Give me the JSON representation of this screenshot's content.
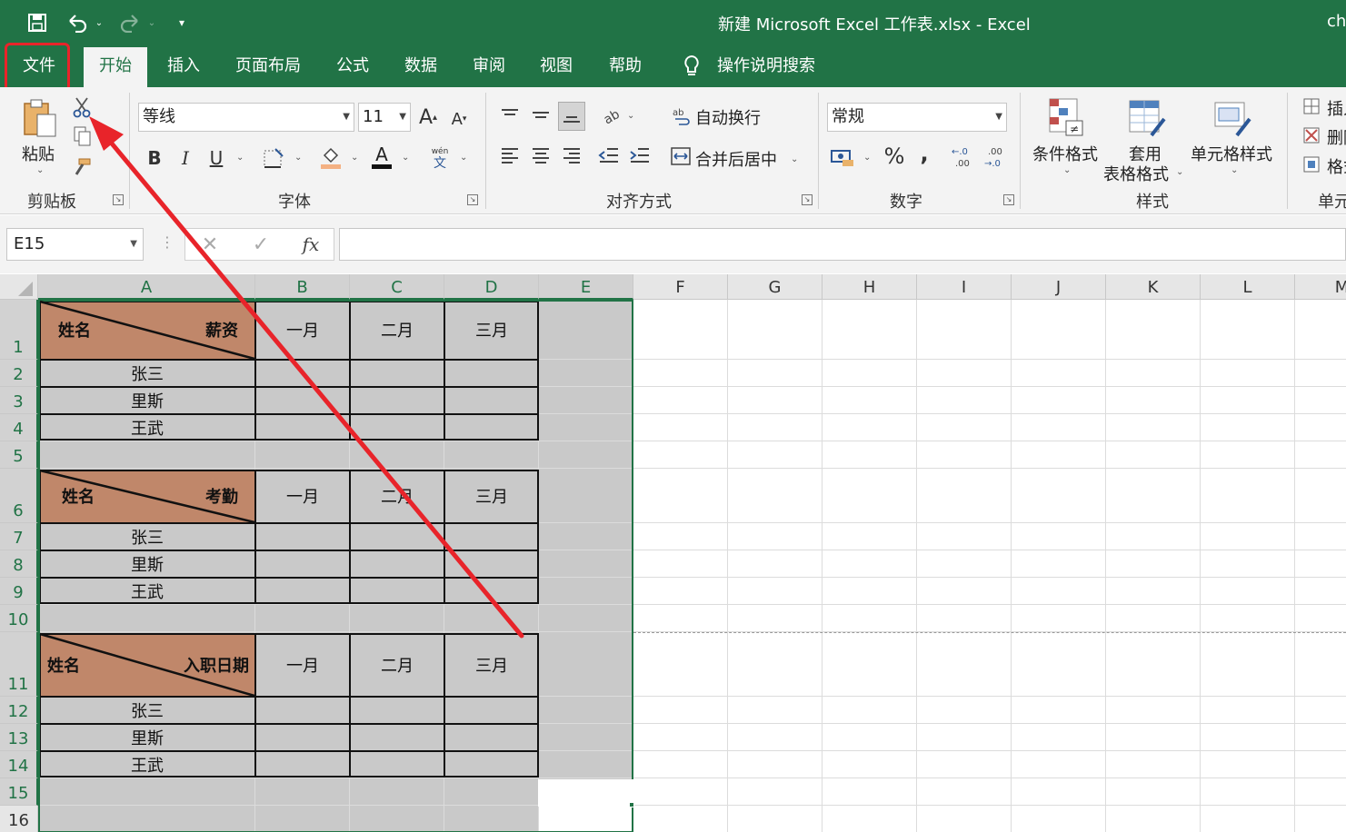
{
  "window": {
    "title": "新建 Microsoft Excel 工作表.xlsx  -  Excel",
    "user": "ch"
  },
  "tabs": {
    "file": "文件",
    "home": "开始",
    "insert": "插入",
    "layout": "页面布局",
    "formulas": "公式",
    "data": "数据",
    "review": "审阅",
    "view": "视图",
    "help": "帮助",
    "tell_me": "操作说明搜索"
  },
  "ribbon": {
    "clipboard": {
      "paste": "粘贴",
      "label": "剪贴板"
    },
    "font": {
      "name": "等线",
      "size": "11",
      "bold": "B",
      "italic": "I",
      "underline": "U",
      "label": "字体"
    },
    "alignment": {
      "wrap": "自动换行",
      "merge": "合并后居中",
      "label": "对齐方式"
    },
    "number": {
      "format": "常规",
      "percent": "%",
      "comma": ",",
      "label": "数字"
    },
    "styles": {
      "conditional_1": "条件格式",
      "table_1": "套用",
      "table_2": "表格格式",
      "cell_styles": "单元格样式",
      "label": "样式"
    },
    "cells": {
      "insert": "插入",
      "delete": "删除",
      "format": "格式",
      "label": "单元"
    }
  },
  "formula_bar": {
    "name_box": "E15",
    "fx": "fx",
    "value": ""
  },
  "columns": [
    "A",
    "B",
    "C",
    "D",
    "E",
    "F",
    "G",
    "H",
    "I",
    "J",
    "K",
    "L",
    "M"
  ],
  "rows": [
    "1",
    "2",
    "3",
    "4",
    "5",
    "6",
    "7",
    "8",
    "9",
    "10",
    "11",
    "12",
    "13",
    "14",
    "15",
    "16"
  ],
  "tables": [
    {
      "left_header": "姓名",
      "right_header": "薪资",
      "months": [
        "一月",
        "二月",
        "三月"
      ],
      "names": [
        "张三",
        "里斯",
        "王武"
      ]
    },
    {
      "left_header": "姓名",
      "right_header": "考勤",
      "months": [
        "一月",
        "二月",
        "三月"
      ],
      "names": [
        "张三",
        "里斯",
        "王武"
      ]
    },
    {
      "left_header": "姓名",
      "right_header": "入职日期",
      "months": [
        "一月",
        "二月",
        "三月"
      ],
      "names": [
        "张三",
        "里斯",
        "王武"
      ]
    }
  ],
  "colors": {
    "accent": "#217346",
    "header_fill": "#c0876a",
    "selection_fill": "#c9c9c9",
    "annotation": "#e8242a"
  }
}
